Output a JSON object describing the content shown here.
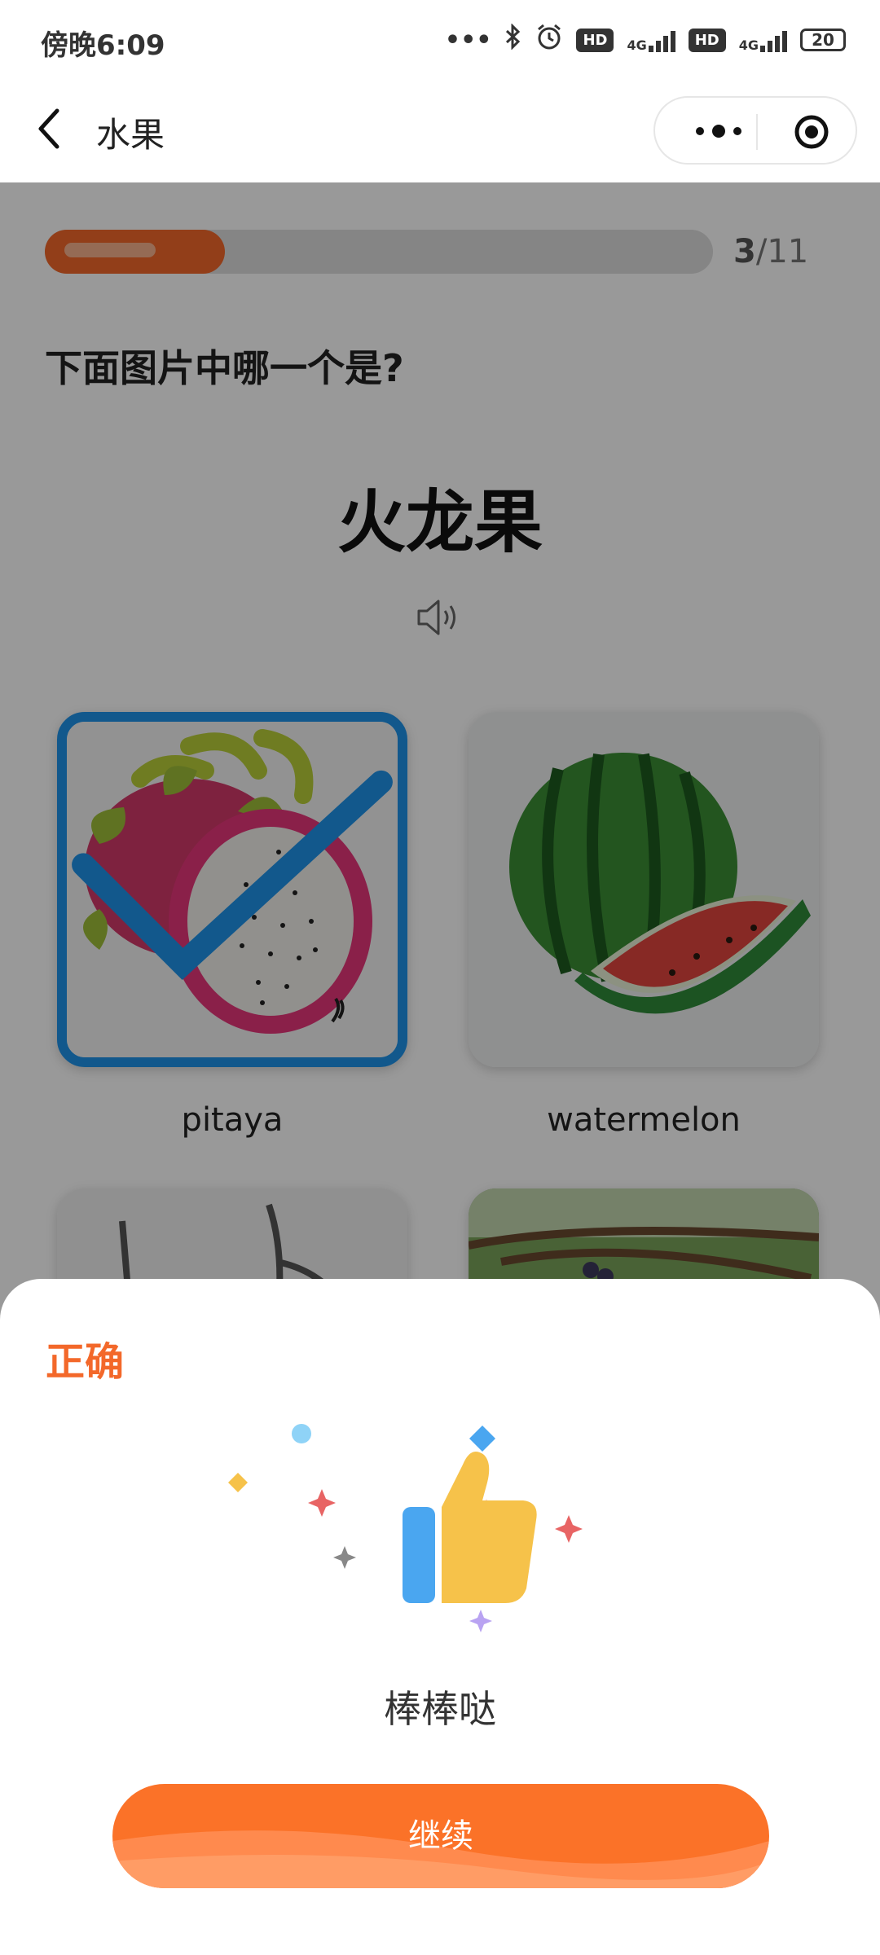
{
  "status_bar": {
    "time": "傍晚6:09",
    "icons": [
      "more-dots-icon",
      "bluetooth-icon",
      "alarm-icon",
      "hd-icon",
      "signal-4g-icon",
      "hd-icon",
      "signal-4g-icon",
      "battery-icon"
    ],
    "hd_label": "HD",
    "network_label": "4G",
    "battery": "20"
  },
  "nav": {
    "title": "水果",
    "back_icon": "chevron-left-icon",
    "more_icon": "more-dots-icon",
    "close_icon": "target-circle-icon"
  },
  "quiz": {
    "progress": {
      "current": "3",
      "total": "/11",
      "fraction": 0.27
    },
    "question": "下面图片中哪一个是?",
    "word": "火龙果",
    "speaker_icon": "speaker-icon",
    "options": [
      {
        "label": "pitaya",
        "image": "dragon-fruit-photo",
        "selected": true
      },
      {
        "label": "watermelon",
        "image": "watermelon-photo",
        "selected": false
      },
      {
        "label": "",
        "image": "branch-photo",
        "selected": false
      },
      {
        "label": "",
        "image": "grape-vine-photo",
        "selected": false
      }
    ]
  },
  "result": {
    "title": "正确",
    "illustration": "thumbs-up-icon",
    "message": "棒棒哒",
    "continue_label": "继续"
  },
  "colors": {
    "accent": "#f3682a",
    "selected_border": "#1f93ea",
    "overlay": "rgba(0,0,0,0.4)"
  }
}
